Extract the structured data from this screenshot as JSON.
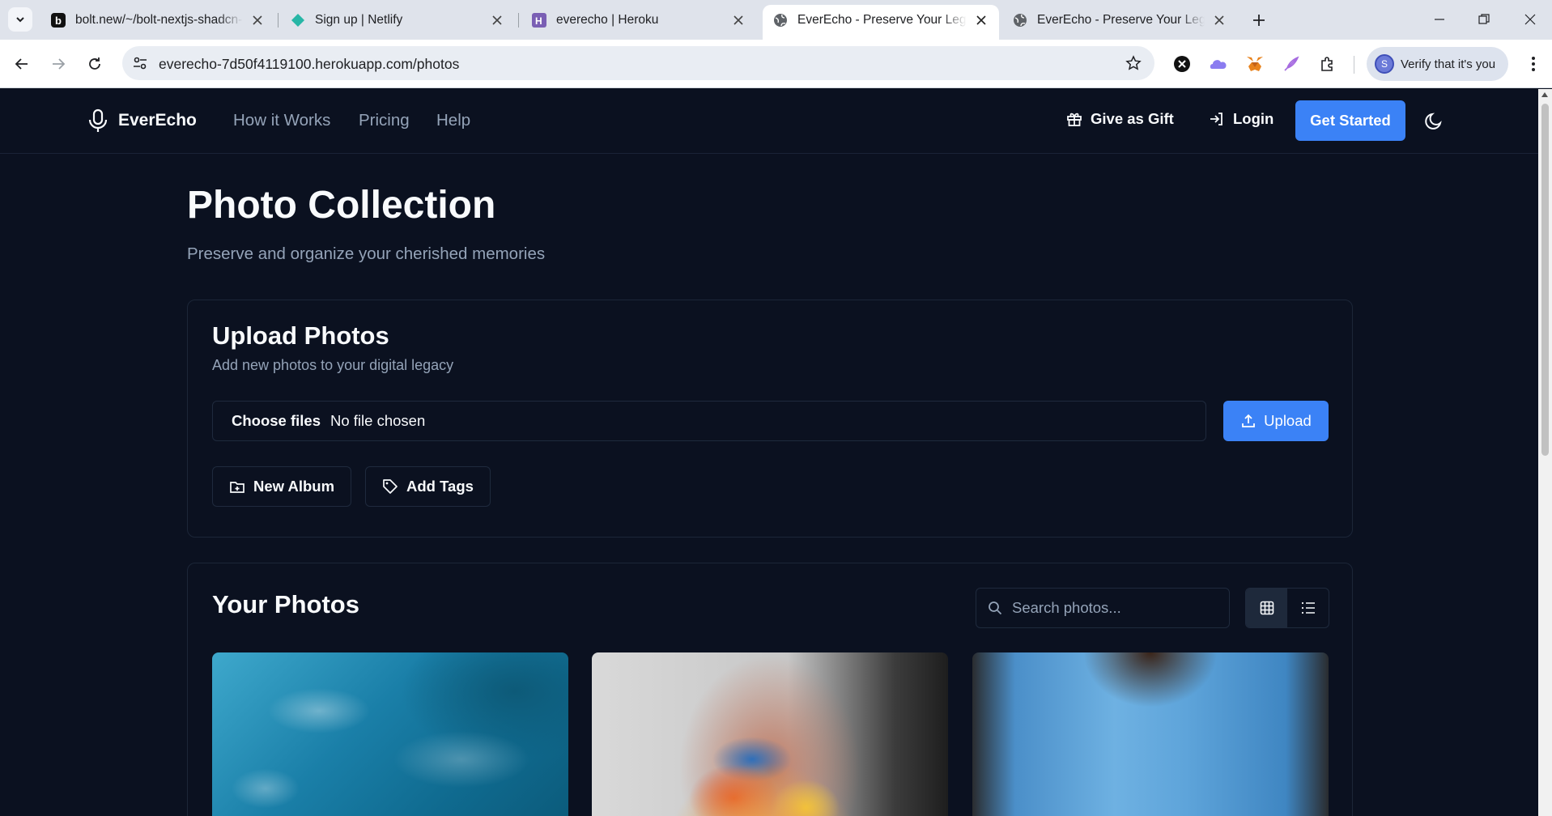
{
  "browser": {
    "tabs": [
      {
        "title": "bolt.new/~/bolt-nextjs-shadcn-",
        "favicon": "bolt-icon"
      },
      {
        "title": "Sign up | Netlify",
        "favicon": "netlify-icon"
      },
      {
        "title": "everecho | Heroku",
        "favicon": "heroku-icon"
      },
      {
        "title": "EverEcho - Preserve Your Legacy",
        "favicon": "globe-icon",
        "active": true
      },
      {
        "title": "EverEcho - Preserve Your Legacy",
        "favicon": "globe-icon"
      }
    ],
    "url": "everecho-7d50f4119100.herokuapp.com/photos",
    "profile_initial": "S",
    "profile_label": "Verify that it's you"
  },
  "site": {
    "brand": "EverEcho",
    "nav": {
      "how": "How it Works",
      "pricing": "Pricing",
      "help": "Help"
    },
    "gift": "Give as Gift",
    "login": "Login",
    "get_started": "Get Started"
  },
  "page": {
    "title": "Photo Collection",
    "subtitle": "Preserve and organize your cherished memories"
  },
  "upload_card": {
    "title": "Upload Photos",
    "description": "Add new photos to your digital legacy",
    "choose_files": "Choose files",
    "no_file": "No file chosen",
    "upload": "Upload",
    "new_album": "New Album",
    "add_tags": "Add Tags"
  },
  "photos_card": {
    "title": "Your Photos",
    "search_placeholder": "Search photos...",
    "view_mode": "grid",
    "photos": [
      {
        "subject": "ocean waves aerial"
      },
      {
        "subject": "paint covered hand"
      },
      {
        "subject": "woman in blue shirt"
      }
    ]
  },
  "colors": {
    "background": "#0b1120",
    "accent": "#3b82f6",
    "muted_text": "#94a3b8",
    "border": "#1c2638"
  }
}
